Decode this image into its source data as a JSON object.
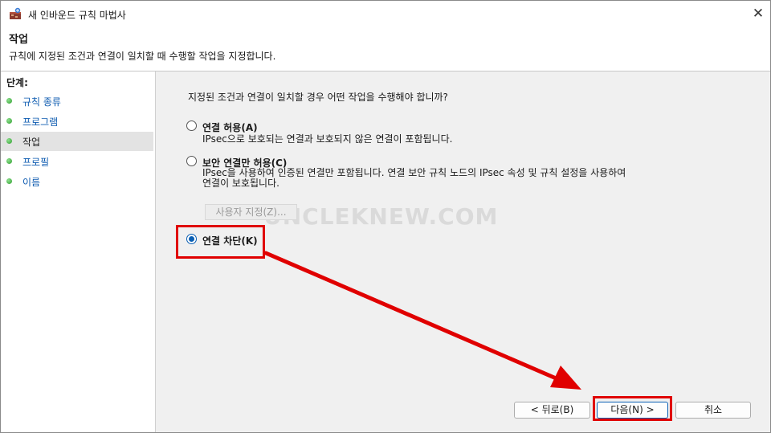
{
  "window": {
    "title": "새 인바운드 규칙 마법사",
    "icon": "firewall-icon",
    "close_label": "✕"
  },
  "header": {
    "title": "작업",
    "description": "규칙에 지정된 조건과 연결이 일치할 때 수행할 작업을 지정합니다."
  },
  "sidebar": {
    "steps_label": "단계:",
    "steps": [
      {
        "label": "규칙 종류",
        "active": false
      },
      {
        "label": "프로그램",
        "active": false
      },
      {
        "label": "작업",
        "active": true
      },
      {
        "label": "프로필",
        "active": false
      },
      {
        "label": "이름",
        "active": false
      }
    ]
  },
  "main": {
    "question": "지정된 조건과 연결이 일치할 경우 어떤 작업을 수행해야 합니까?",
    "options": [
      {
        "label": "연결 허용(A)",
        "description": "IPsec으로 보호되는 연결과 보호되지 않은 연결이 포함됩니다.",
        "checked": false
      },
      {
        "label": "보안 연결만 허용(C)",
        "description": "IPsec을 사용하여 인증된 연결만 포함됩니다. 연결 보안 규칙 노드의 IPsec 속성 및 규칙 설정을 사용하여 연결이 보호됩니다.",
        "checked": false
      },
      {
        "label": "연결 차단(K)",
        "description": "",
        "checked": true
      }
    ],
    "custom_button": "사용자 지정(Z)...",
    "watermark": "UNCLEKNEW.COM"
  },
  "footer": {
    "back": "< 뒤로(B)",
    "next": "다음(N) >",
    "cancel": "취소"
  },
  "colors": {
    "highlight": "#e00000",
    "link": "#0d5bb0",
    "radio_selected": "#0a5fb4",
    "step_dot": "#2f9e2f"
  }
}
